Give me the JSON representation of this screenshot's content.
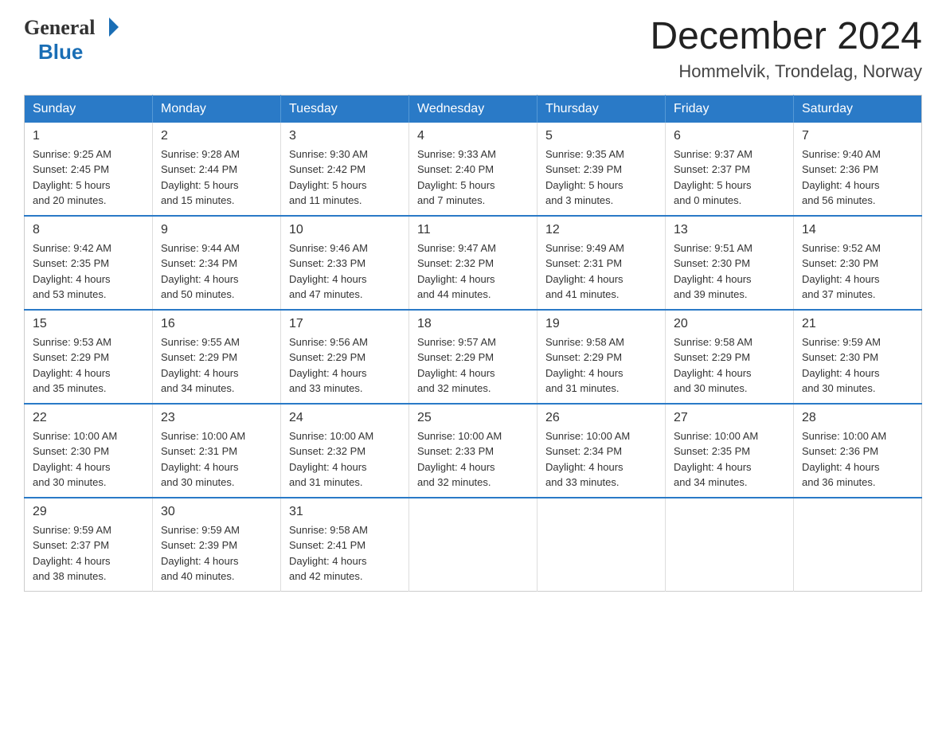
{
  "header": {
    "logo_text_general": "General",
    "logo_text_blue": "Blue",
    "month_title": "December 2024",
    "location": "Hommelvik, Trondelag, Norway"
  },
  "days_of_week": [
    "Sunday",
    "Monday",
    "Tuesday",
    "Wednesday",
    "Thursday",
    "Friday",
    "Saturday"
  ],
  "weeks": [
    [
      {
        "day": "1",
        "sunrise": "Sunrise: 9:25 AM",
        "sunset": "Sunset: 2:45 PM",
        "daylight": "Daylight: 5 hours",
        "daylight2": "and 20 minutes."
      },
      {
        "day": "2",
        "sunrise": "Sunrise: 9:28 AM",
        "sunset": "Sunset: 2:44 PM",
        "daylight": "Daylight: 5 hours",
        "daylight2": "and 15 minutes."
      },
      {
        "day": "3",
        "sunrise": "Sunrise: 9:30 AM",
        "sunset": "Sunset: 2:42 PM",
        "daylight": "Daylight: 5 hours",
        "daylight2": "and 11 minutes."
      },
      {
        "day": "4",
        "sunrise": "Sunrise: 9:33 AM",
        "sunset": "Sunset: 2:40 PM",
        "daylight": "Daylight: 5 hours",
        "daylight2": "and 7 minutes."
      },
      {
        "day": "5",
        "sunrise": "Sunrise: 9:35 AM",
        "sunset": "Sunset: 2:39 PM",
        "daylight": "Daylight: 5 hours",
        "daylight2": "and 3 minutes."
      },
      {
        "day": "6",
        "sunrise": "Sunrise: 9:37 AM",
        "sunset": "Sunset: 2:37 PM",
        "daylight": "Daylight: 5 hours",
        "daylight2": "and 0 minutes."
      },
      {
        "day": "7",
        "sunrise": "Sunrise: 9:40 AM",
        "sunset": "Sunset: 2:36 PM",
        "daylight": "Daylight: 4 hours",
        "daylight2": "and 56 minutes."
      }
    ],
    [
      {
        "day": "8",
        "sunrise": "Sunrise: 9:42 AM",
        "sunset": "Sunset: 2:35 PM",
        "daylight": "Daylight: 4 hours",
        "daylight2": "and 53 minutes."
      },
      {
        "day": "9",
        "sunrise": "Sunrise: 9:44 AM",
        "sunset": "Sunset: 2:34 PM",
        "daylight": "Daylight: 4 hours",
        "daylight2": "and 50 minutes."
      },
      {
        "day": "10",
        "sunrise": "Sunrise: 9:46 AM",
        "sunset": "Sunset: 2:33 PM",
        "daylight": "Daylight: 4 hours",
        "daylight2": "and 47 minutes."
      },
      {
        "day": "11",
        "sunrise": "Sunrise: 9:47 AM",
        "sunset": "Sunset: 2:32 PM",
        "daylight": "Daylight: 4 hours",
        "daylight2": "and 44 minutes."
      },
      {
        "day": "12",
        "sunrise": "Sunrise: 9:49 AM",
        "sunset": "Sunset: 2:31 PM",
        "daylight": "Daylight: 4 hours",
        "daylight2": "and 41 minutes."
      },
      {
        "day": "13",
        "sunrise": "Sunrise: 9:51 AM",
        "sunset": "Sunset: 2:30 PM",
        "daylight": "Daylight: 4 hours",
        "daylight2": "and 39 minutes."
      },
      {
        "day": "14",
        "sunrise": "Sunrise: 9:52 AM",
        "sunset": "Sunset: 2:30 PM",
        "daylight": "Daylight: 4 hours",
        "daylight2": "and 37 minutes."
      }
    ],
    [
      {
        "day": "15",
        "sunrise": "Sunrise: 9:53 AM",
        "sunset": "Sunset: 2:29 PM",
        "daylight": "Daylight: 4 hours",
        "daylight2": "and 35 minutes."
      },
      {
        "day": "16",
        "sunrise": "Sunrise: 9:55 AM",
        "sunset": "Sunset: 2:29 PM",
        "daylight": "Daylight: 4 hours",
        "daylight2": "and 34 minutes."
      },
      {
        "day": "17",
        "sunrise": "Sunrise: 9:56 AM",
        "sunset": "Sunset: 2:29 PM",
        "daylight": "Daylight: 4 hours",
        "daylight2": "and 33 minutes."
      },
      {
        "day": "18",
        "sunrise": "Sunrise: 9:57 AM",
        "sunset": "Sunset: 2:29 PM",
        "daylight": "Daylight: 4 hours",
        "daylight2": "and 32 minutes."
      },
      {
        "day": "19",
        "sunrise": "Sunrise: 9:58 AM",
        "sunset": "Sunset: 2:29 PM",
        "daylight": "Daylight: 4 hours",
        "daylight2": "and 31 minutes."
      },
      {
        "day": "20",
        "sunrise": "Sunrise: 9:58 AM",
        "sunset": "Sunset: 2:29 PM",
        "daylight": "Daylight: 4 hours",
        "daylight2": "and 30 minutes."
      },
      {
        "day": "21",
        "sunrise": "Sunrise: 9:59 AM",
        "sunset": "Sunset: 2:30 PM",
        "daylight": "Daylight: 4 hours",
        "daylight2": "and 30 minutes."
      }
    ],
    [
      {
        "day": "22",
        "sunrise": "Sunrise: 10:00 AM",
        "sunset": "Sunset: 2:30 PM",
        "daylight": "Daylight: 4 hours",
        "daylight2": "and 30 minutes."
      },
      {
        "day": "23",
        "sunrise": "Sunrise: 10:00 AM",
        "sunset": "Sunset: 2:31 PM",
        "daylight": "Daylight: 4 hours",
        "daylight2": "and 30 minutes."
      },
      {
        "day": "24",
        "sunrise": "Sunrise: 10:00 AM",
        "sunset": "Sunset: 2:32 PM",
        "daylight": "Daylight: 4 hours",
        "daylight2": "and 31 minutes."
      },
      {
        "day": "25",
        "sunrise": "Sunrise: 10:00 AM",
        "sunset": "Sunset: 2:33 PM",
        "daylight": "Daylight: 4 hours",
        "daylight2": "and 32 minutes."
      },
      {
        "day": "26",
        "sunrise": "Sunrise: 10:00 AM",
        "sunset": "Sunset: 2:34 PM",
        "daylight": "Daylight: 4 hours",
        "daylight2": "and 33 minutes."
      },
      {
        "day": "27",
        "sunrise": "Sunrise: 10:00 AM",
        "sunset": "Sunset: 2:35 PM",
        "daylight": "Daylight: 4 hours",
        "daylight2": "and 34 minutes."
      },
      {
        "day": "28",
        "sunrise": "Sunrise: 10:00 AM",
        "sunset": "Sunset: 2:36 PM",
        "daylight": "Daylight: 4 hours",
        "daylight2": "and 36 minutes."
      }
    ],
    [
      {
        "day": "29",
        "sunrise": "Sunrise: 9:59 AM",
        "sunset": "Sunset: 2:37 PM",
        "daylight": "Daylight: 4 hours",
        "daylight2": "and 38 minutes."
      },
      {
        "day": "30",
        "sunrise": "Sunrise: 9:59 AM",
        "sunset": "Sunset: 2:39 PM",
        "daylight": "Daylight: 4 hours",
        "daylight2": "and 40 minutes."
      },
      {
        "day": "31",
        "sunrise": "Sunrise: 9:58 AM",
        "sunset": "Sunset: 2:41 PM",
        "daylight": "Daylight: 4 hours",
        "daylight2": "and 42 minutes."
      },
      null,
      null,
      null,
      null
    ]
  ]
}
